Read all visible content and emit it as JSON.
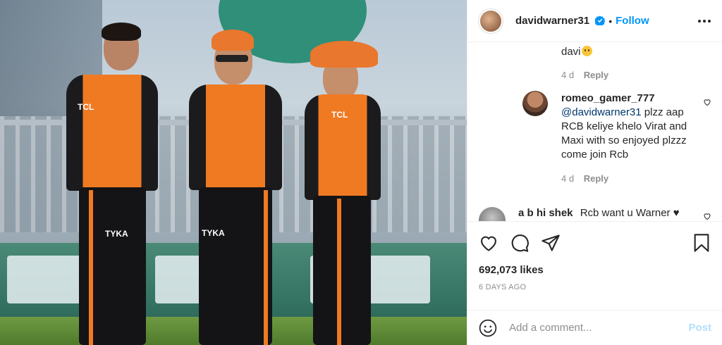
{
  "photo": {
    "sponsors": [
      "TCL",
      "TYKA",
      "TYKA",
      "TCL"
    ]
  },
  "header": {
    "username": "davidwarner31",
    "dot": "•",
    "follow_label": "Follow",
    "more_icon": "more-dots-icon"
  },
  "comments": {
    "fragment": {
      "text": "davi",
      "emoji": "sad-face-emoji",
      "age": "4 d",
      "reply_label": "Reply"
    },
    "reply_comment": {
      "username": "romeo_gamer_777",
      "mention": "@davidwarner31",
      "text": " plzz aap RCB keliye khelo Virat and Maxi with so enjoyed plzzz come join Rcb",
      "age": "4 d",
      "reply_label": "Reply"
    },
    "partial_comment": {
      "username": "a b hi shek",
      "text": "Rcb want u Warner ♥"
    }
  },
  "actions": {
    "icons": [
      "heart-icon",
      "comment-icon",
      "share-icon",
      "save-icon"
    ],
    "likes": "692,073 likes",
    "posted": "6 DAYS AGO"
  },
  "add_comment": {
    "placeholder": "Add a comment...",
    "post_label": "Post"
  },
  "colors": {
    "accent": "#0095f6",
    "post_disabled": "#b2dffc",
    "text": "#262626",
    "muted": "#8e8e8e"
  }
}
